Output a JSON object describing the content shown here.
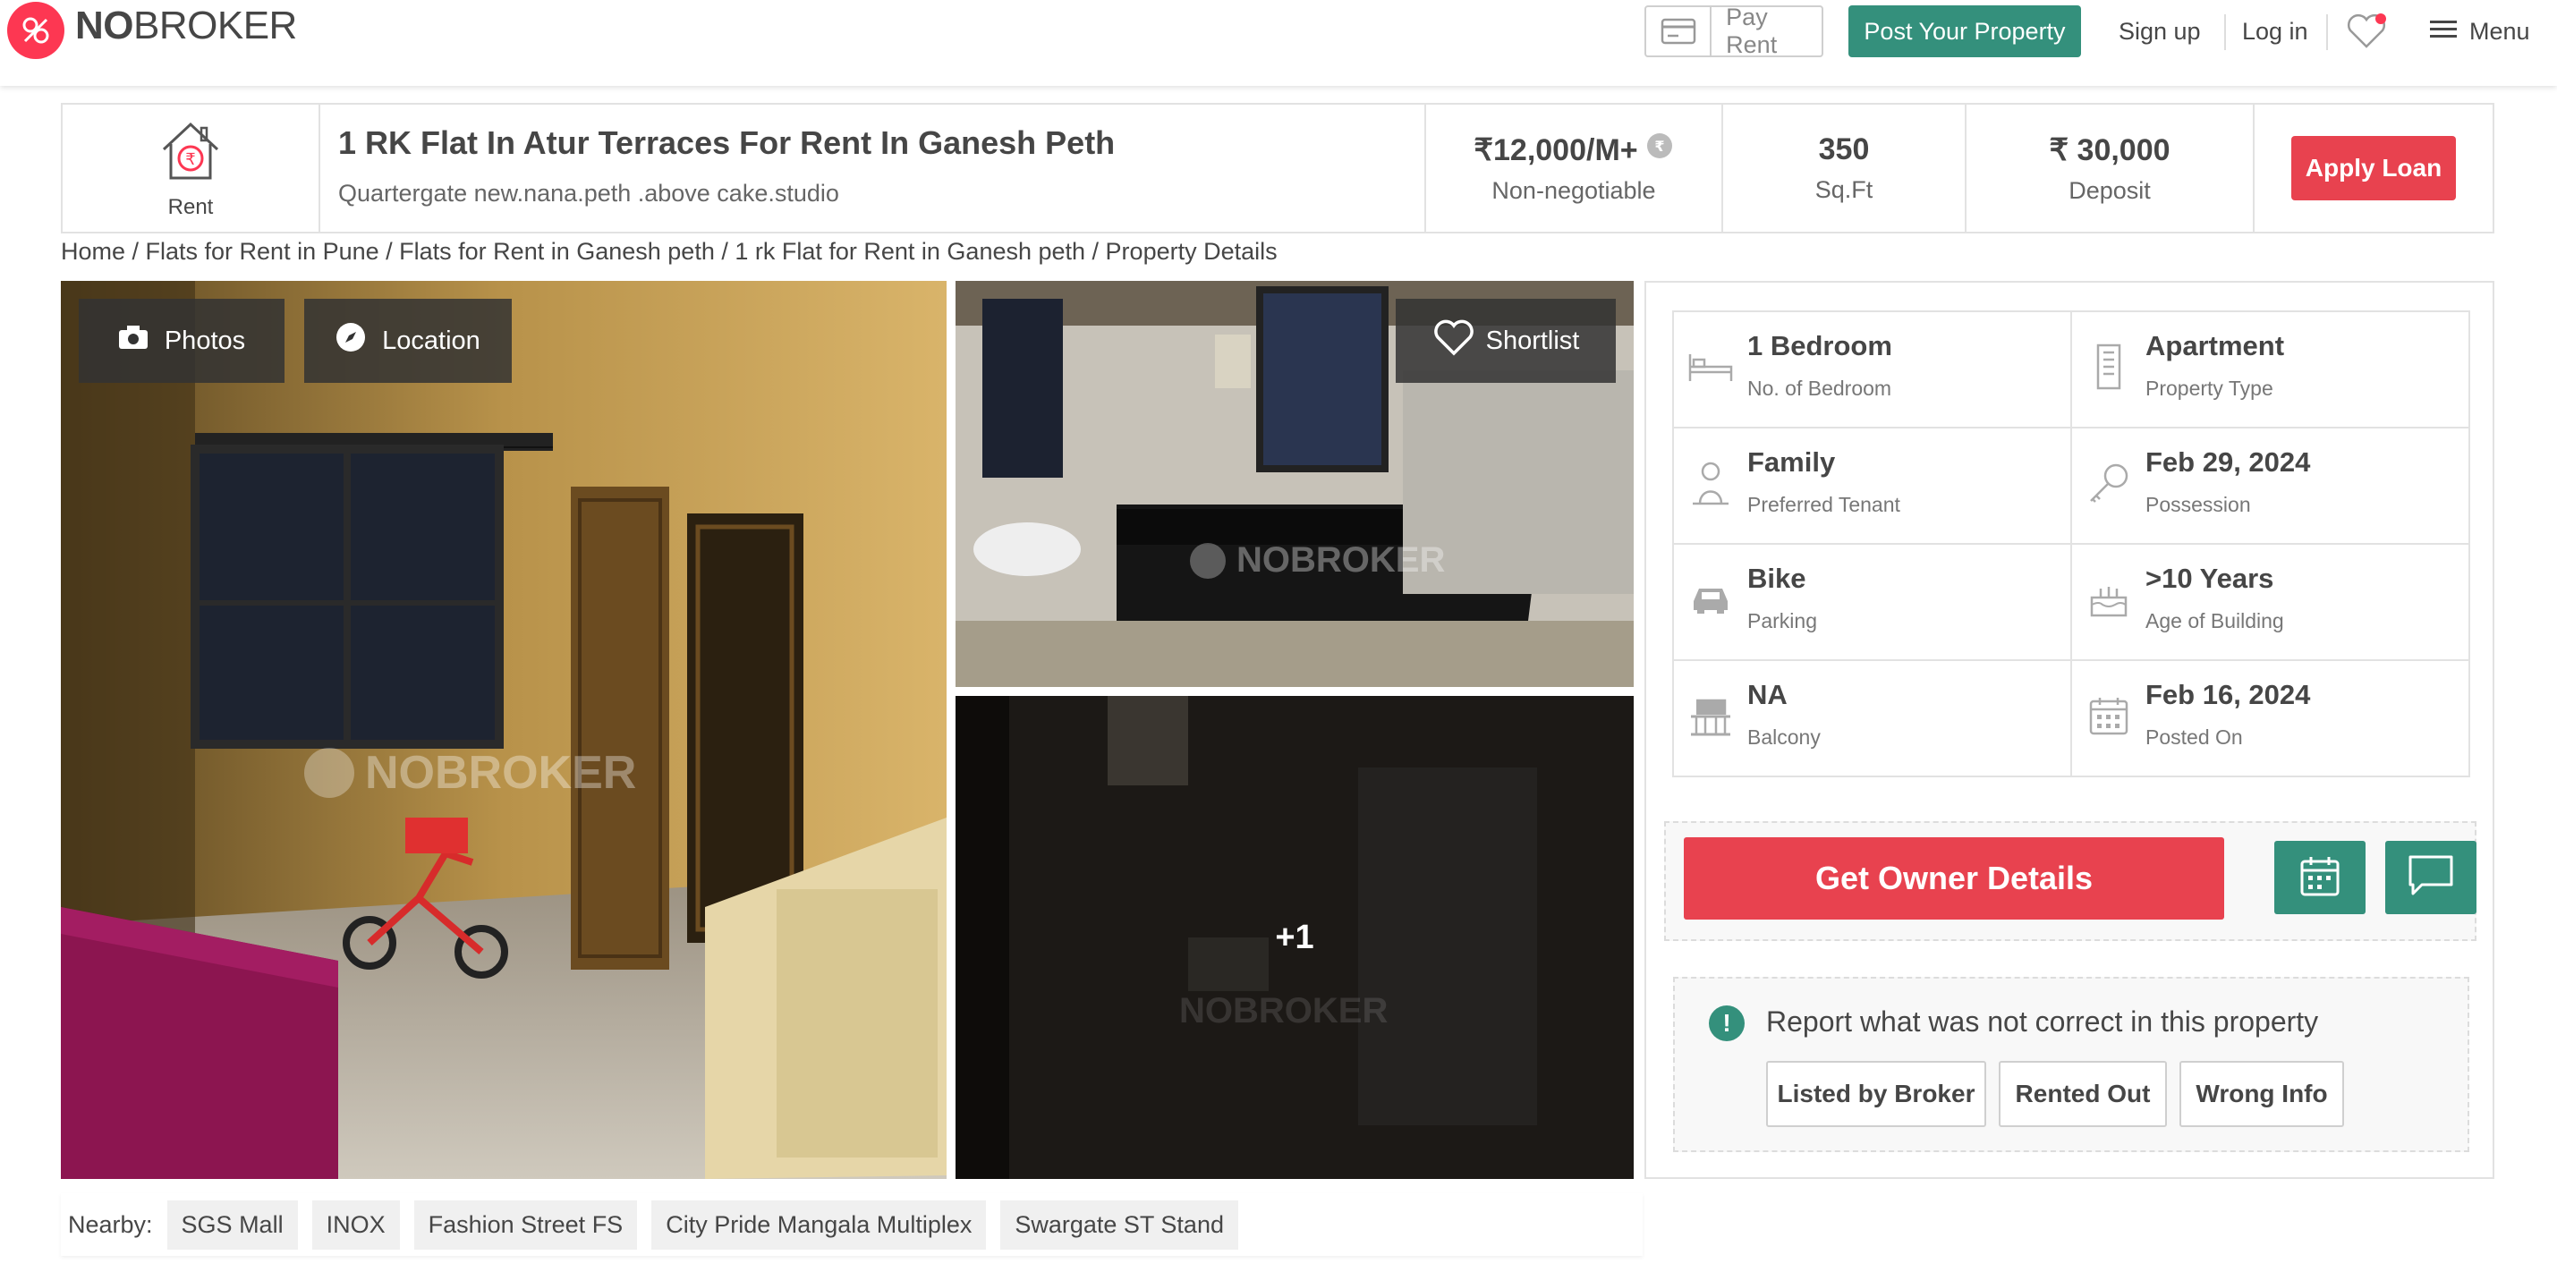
{
  "header": {
    "logo_bold": "NO",
    "logo_light": "BROKER",
    "pay_rent": "Pay Rent",
    "post_property": "Post Your Property",
    "sign_up": "Sign up",
    "log_in": "Log in",
    "menu": "Menu"
  },
  "summary": {
    "type_label": "Rent",
    "title": "1 RK Flat In Atur Terraces For Rent In Ganesh Peth",
    "address": "Quartergate new.nana.peth .above cake.studio",
    "rent_value": "₹12,000/M+",
    "rent_note": "Non-negotiable",
    "area_value": "350",
    "area_unit": "Sq.Ft",
    "deposit_value": "₹ 30,000",
    "deposit_label": "Deposit",
    "apply_loan": "Apply Loan"
  },
  "breadcrumb": "Home / Flats for Rent in Pune / Flats for Rent in Ganesh peth / 1 rk Flat for Rent in Ganesh peth / Property Details",
  "gallery": {
    "photos": "Photos",
    "location": "Location",
    "shortlist": "Shortlist",
    "more_count": "+1",
    "watermark": "NOBROKER"
  },
  "details": [
    {
      "value": "1 Bedroom",
      "label": "No. of Bedroom",
      "icon": "bed-icon"
    },
    {
      "value": "Apartment",
      "label": "Property Type",
      "icon": "building-icon"
    },
    {
      "value": "Family",
      "label": "Preferred Tenant",
      "icon": "tenant-icon"
    },
    {
      "value": "Feb 29, 2024",
      "label": "Possession",
      "icon": "key-icon"
    },
    {
      "value": "Bike",
      "label": "Parking",
      "icon": "car-icon"
    },
    {
      "value": ">10 Years",
      "label": "Age of Building",
      "icon": "cake-icon"
    },
    {
      "value": "NA",
      "label": "Balcony",
      "icon": "balcony-icon"
    },
    {
      "value": "Feb 16, 2024",
      "label": "Posted On",
      "icon": "calendar-icon"
    }
  ],
  "owner": {
    "button": "Get Owner Details"
  },
  "report": {
    "question": "Report what was not correct in this property",
    "options": [
      "Listed by Broker",
      "Rented Out",
      "Wrong Info"
    ]
  },
  "nearby": {
    "label": "Nearby:",
    "places": [
      "SGS Mall",
      "INOX",
      "Fashion Street FS",
      "City Pride Mangala Multiplex",
      "Swargate ST Stand"
    ]
  },
  "colors": {
    "brand_red": "#fd3752",
    "accent_green": "#34907c",
    "button_red": "#e8424f"
  }
}
